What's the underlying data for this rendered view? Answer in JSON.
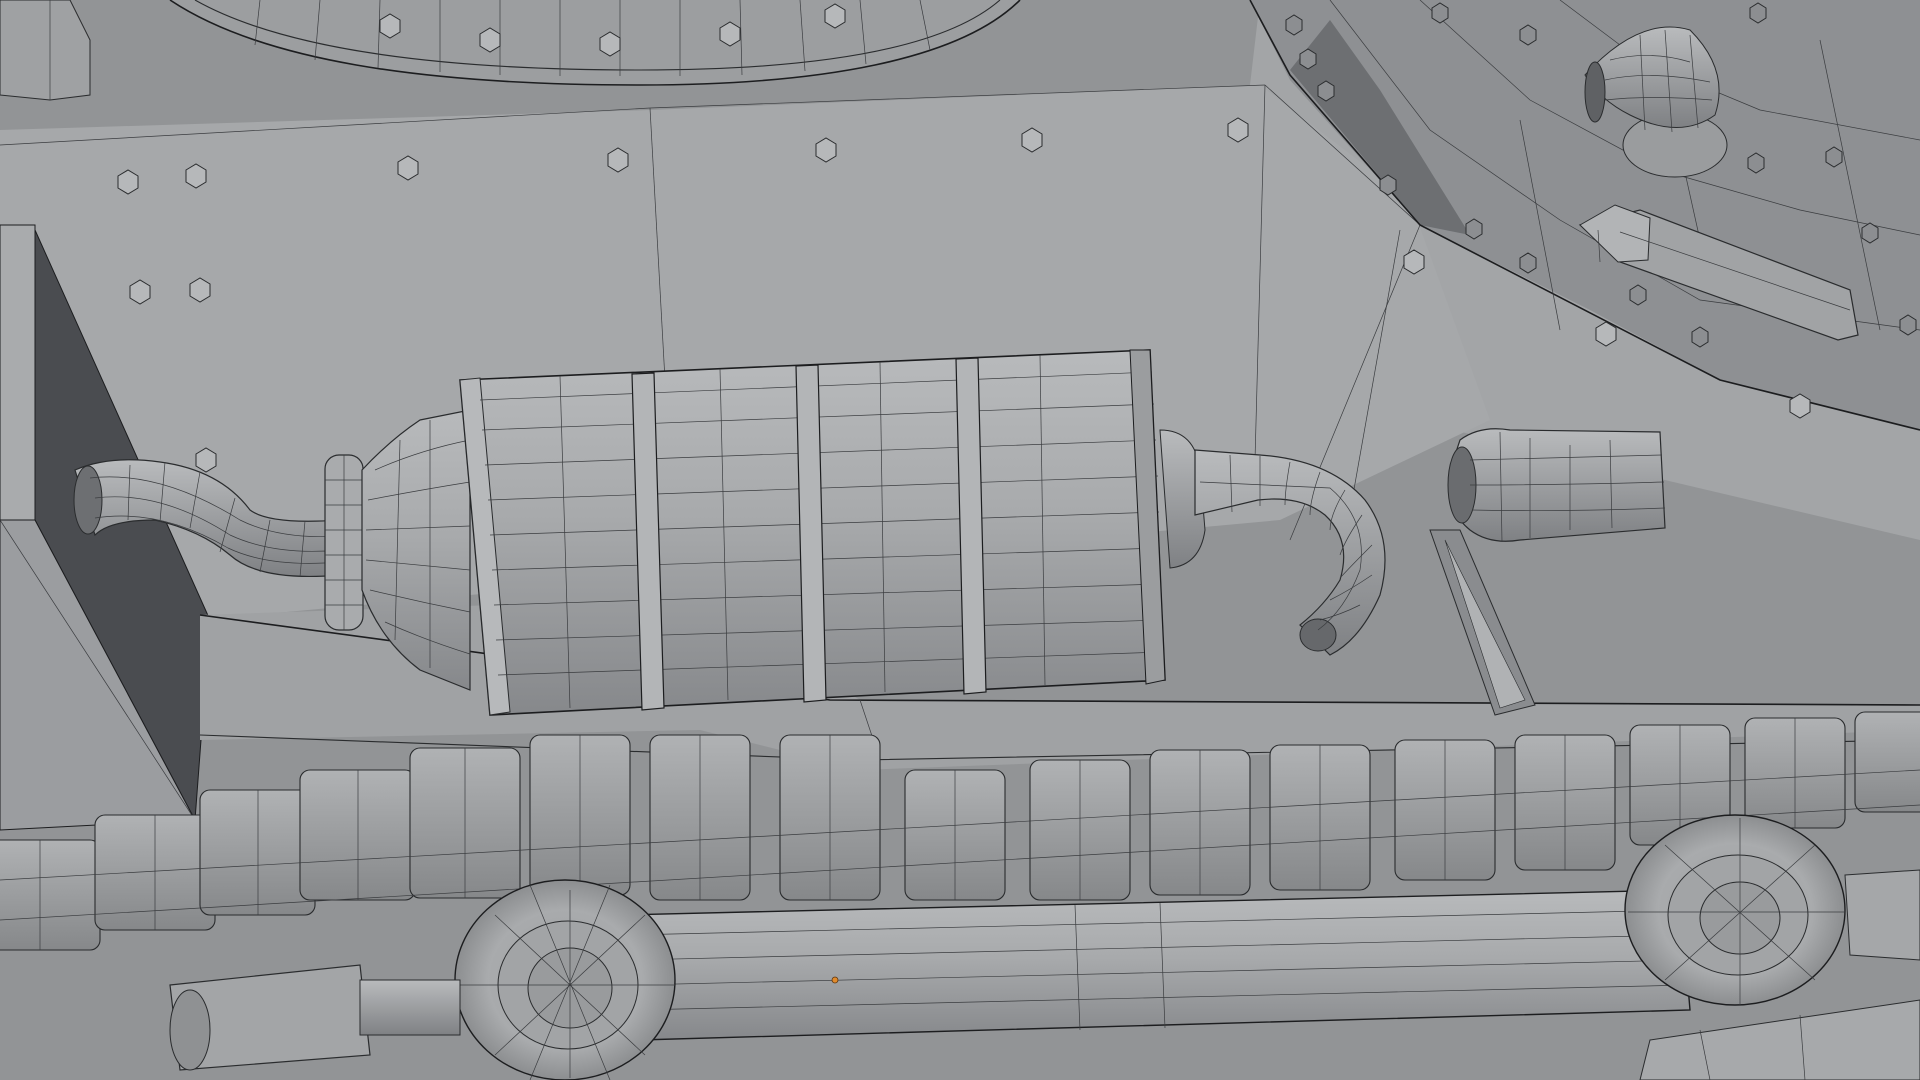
{
  "app": {
    "title": "",
    "view": "viewport-wireframe-overlay"
  },
  "scene": {
    "subject": "tank-hull-side",
    "parts": [
      "muffler",
      "exhaust-inlet-pipe",
      "exhaust-outlet-pipe",
      "exhaust-flare-nozzle",
      "upper-left-bolt-cluster",
      "track-links",
      "road-wheel-left",
      "road-wheel-right",
      "return-roller",
      "turret-ring",
      "sloped-armor-plate",
      "hinge-bracket",
      "tow-cone-upper",
      "fender-plate",
      "side-vertical-plate"
    ]
  },
  "colors": {
    "viewport_bg": "#929496",
    "mesh_base": "#a4a6a8",
    "mesh_light": "#b3b5b7",
    "mesh_shadow": "#6f7174",
    "wire": "#2a2c2e",
    "selected_vertex": "#e08a2c"
  },
  "icons": {
    "selected_vertex": "origin-dot-icon"
  }
}
